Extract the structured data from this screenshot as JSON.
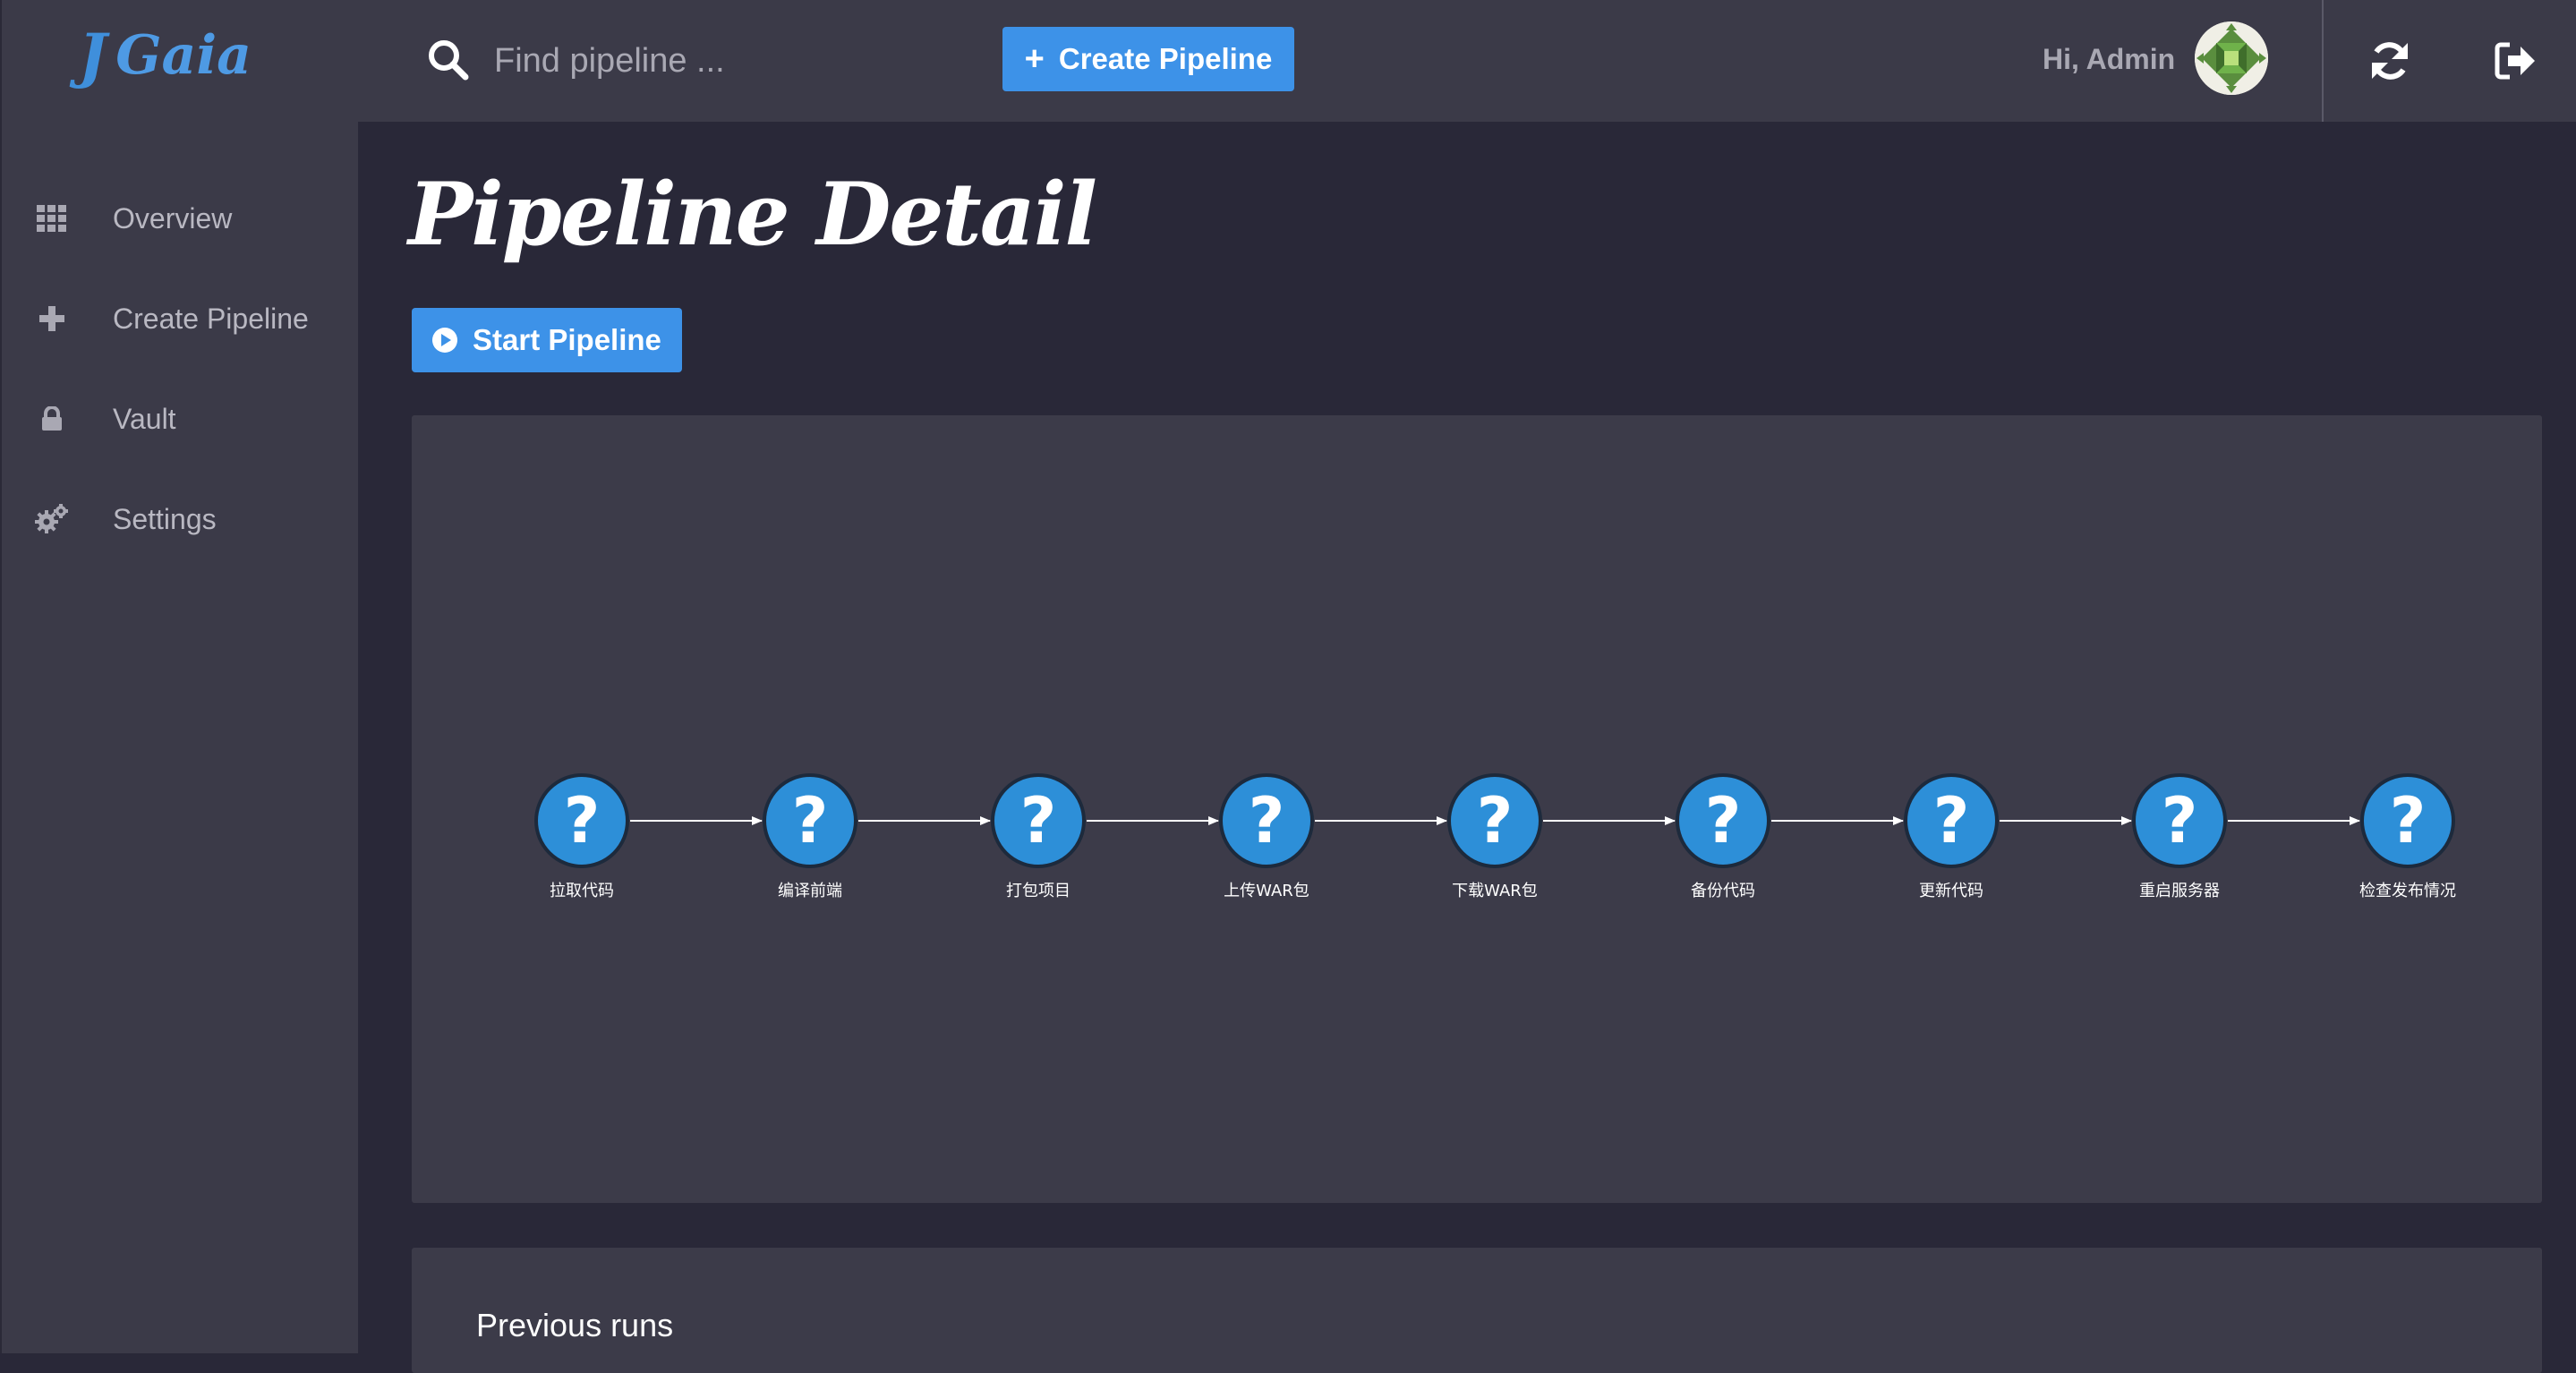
{
  "app": {
    "brand_name": "Gaia",
    "brand_color": "#4e9ae4"
  },
  "sidebar": {
    "items": [
      {
        "label": "Overview",
        "icon": "grid-icon"
      },
      {
        "label": "Create Pipeline",
        "icon": "plus-icon"
      },
      {
        "label": "Vault",
        "icon": "lock-icon"
      },
      {
        "label": "Settings",
        "icon": "gears-icon"
      }
    ]
  },
  "topbar": {
    "search_placeholder": "Find pipeline ...",
    "create_button_label": "Create Pipeline",
    "greeting": "Hi, Admin"
  },
  "main": {
    "title": "Pipeline Detail",
    "start_button_label": "Start Pipeline",
    "previous_runs_title": "Previous runs"
  },
  "pipeline_graph": {
    "node_symbol": "?",
    "node_color": "#2d8fd8",
    "nodes": [
      "拉取代码",
      "编译前端",
      "打包项目",
      "上传WAR包",
      "下载WAR包",
      "备份代码",
      "更新代码",
      "重启服务器",
      "检查发布情况"
    ]
  },
  "colors": {
    "accent": "#3d92e8",
    "sidebar_bg": "#3b3a48",
    "page_bg": "#292838",
    "panel_bg": "#3c3b49"
  }
}
